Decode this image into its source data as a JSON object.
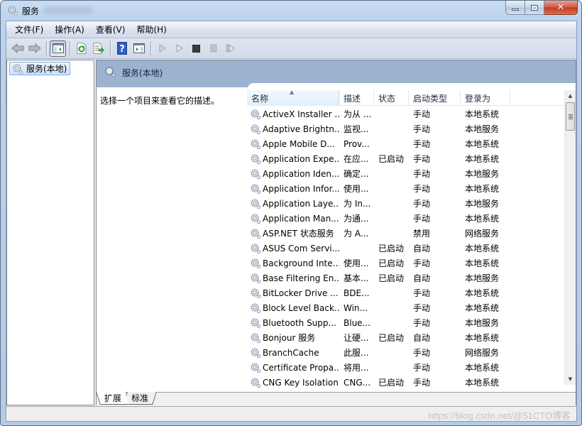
{
  "window": {
    "title": "服务",
    "caption": {
      "minimize": "minimize",
      "maximize": "maximize",
      "close": "close"
    }
  },
  "menubar": {
    "items": [
      {
        "label": "文件(F)"
      },
      {
        "label": "操作(A)"
      },
      {
        "label": "查看(V)"
      },
      {
        "label": "帮助(H)"
      }
    ]
  },
  "toolbar": {
    "buttons": [
      {
        "icon": "back-arrow-icon",
        "enabled": false
      },
      {
        "icon": "forward-arrow-icon",
        "enabled": false
      },
      {
        "icon": "show-hide-console-tree-icon",
        "pressed": true
      },
      {
        "icon": "refresh-icon"
      },
      {
        "icon": "export-list-icon"
      },
      {
        "icon": "help-icon"
      },
      {
        "icon": "show-action-pane-icon"
      },
      {
        "icon": "start-service-icon",
        "enabled": false
      },
      {
        "icon": "start-service-alt-icon",
        "enabled": false
      },
      {
        "icon": "stop-service-icon"
      },
      {
        "icon": "pause-service-icon",
        "enabled": false
      },
      {
        "icon": "restart-service-icon",
        "enabled": false
      }
    ]
  },
  "tree": {
    "root_label": "服务(本地)"
  },
  "main": {
    "banner_title": "服务(本地)",
    "description_hint": "选择一个项目来查看它的描述。",
    "columns": {
      "name": "名称",
      "desc": "描述",
      "status": "状态",
      "startup": "启动类型",
      "logon": "登录为"
    },
    "sort": {
      "column": "name",
      "direction": "ascending"
    },
    "rows": [
      {
        "name": "ActiveX Installer ...",
        "desc": "为从 ...",
        "status": "",
        "startup": "手动",
        "logon": "本地系统"
      },
      {
        "name": "Adaptive Brightn...",
        "desc": "监视...",
        "status": "",
        "startup": "手动",
        "logon": "本地服务"
      },
      {
        "name": "Apple Mobile D...",
        "desc": "Prov...",
        "status": "",
        "startup": "手动",
        "logon": "本地系统"
      },
      {
        "name": "Application Expe...",
        "desc": "在应...",
        "status": "已启动",
        "startup": "手动",
        "logon": "本地系统"
      },
      {
        "name": "Application Iden...",
        "desc": "确定...",
        "status": "",
        "startup": "手动",
        "logon": "本地服务"
      },
      {
        "name": "Application Infor...",
        "desc": "使用...",
        "status": "",
        "startup": "手动",
        "logon": "本地系统"
      },
      {
        "name": "Application Laye...",
        "desc": "为 In...",
        "status": "",
        "startup": "手动",
        "logon": "本地服务"
      },
      {
        "name": "Application Man...",
        "desc": "为通...",
        "status": "",
        "startup": "手动",
        "logon": "本地系统"
      },
      {
        "name": "ASP.NET 状态服务",
        "desc": "为 A...",
        "status": "",
        "startup": "禁用",
        "logon": "网络服务"
      },
      {
        "name": "ASUS Com Servi...",
        "desc": "",
        "status": "已启动",
        "startup": "自动",
        "logon": "本地系统"
      },
      {
        "name": "Background Inte...",
        "desc": "使用...",
        "status": "已启动",
        "startup": "手动",
        "logon": "本地系统"
      },
      {
        "name": "Base Filtering En...",
        "desc": "基本...",
        "status": "已启动",
        "startup": "自动",
        "logon": "本地服务"
      },
      {
        "name": "BitLocker Drive ...",
        "desc": "BDE...",
        "status": "",
        "startup": "手动",
        "logon": "本地系统"
      },
      {
        "name": "Block Level Back...",
        "desc": "Win...",
        "status": "",
        "startup": "手动",
        "logon": "本地系统"
      },
      {
        "name": "Bluetooth Supp...",
        "desc": "Blue...",
        "status": "",
        "startup": "手动",
        "logon": "本地服务"
      },
      {
        "name": "Bonjour 服务",
        "desc": "让硬...",
        "status": "已启动",
        "startup": "自动",
        "logon": "本地系统"
      },
      {
        "name": "BranchCache",
        "desc": "此服...",
        "status": "",
        "startup": "手动",
        "logon": "网络服务"
      },
      {
        "name": "Certificate Propa...",
        "desc": "将用...",
        "status": "",
        "startup": "手动",
        "logon": "本地系统"
      },
      {
        "name": "CNG Key Isolation",
        "desc": "CNG...",
        "status": "已启动",
        "startup": "手动",
        "logon": "本地系统"
      }
    ],
    "tabs": [
      {
        "label": "扩展",
        "active": true
      },
      {
        "label": "标准",
        "active": false
      }
    ]
  },
  "statusbar": {
    "watermark": "https://blog.csdn.net/@51CTO博客"
  },
  "colors": {
    "banner": "#9cb3d0",
    "selection_border": "#84acdd",
    "close_button": "#c23a22"
  }
}
